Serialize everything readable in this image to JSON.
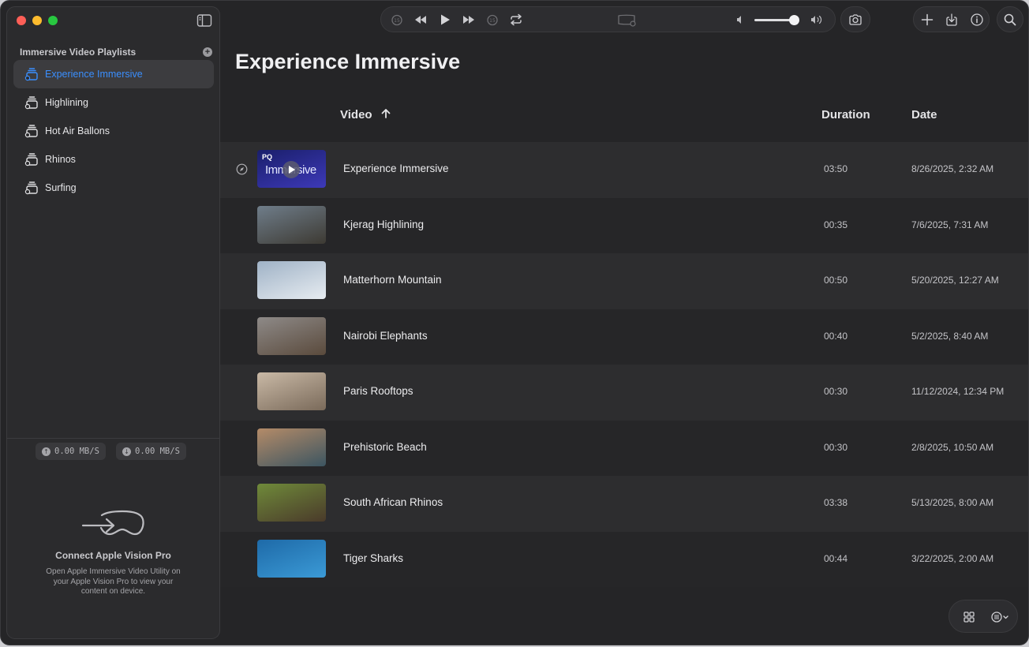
{
  "sidebar": {
    "header": "Immersive Video Playlists",
    "playlists": [
      {
        "label": "Experience Immersive",
        "active": true
      },
      {
        "label": "Highlining",
        "active": false
      },
      {
        "label": "Hot Air Ballons",
        "active": false
      },
      {
        "label": "Rhinos",
        "active": false
      },
      {
        "label": "Surfing",
        "active": false
      }
    ],
    "upload_rate": "0.00 MB/S",
    "download_rate": "0.00 MB/S",
    "connect": {
      "title": "Connect Apple Vision Pro",
      "description": "Open Apple Immersive Video Utility on your Apple Vision Pro to view your content on device."
    }
  },
  "toolbar": {
    "icons": [
      "skip-back-15-icon",
      "rewind-icon",
      "play-icon",
      "fast-forward-icon",
      "skip-forward-15-icon",
      "repeat-icon",
      "screen-placeholder-icon",
      "volume-low-icon",
      "volume-high-icon",
      "camera-icon",
      "plus-icon",
      "import-icon",
      "info-icon",
      "search-icon"
    ],
    "volume_level": 0.9
  },
  "main": {
    "title": "Experience Immersive",
    "columns": {
      "video": "Video",
      "duration": "Duration",
      "date": "Date"
    },
    "rows": [
      {
        "title": "Experience Immersive",
        "duration": "03:50",
        "date": "8/26/2025, 2:32 AM",
        "thumb_text_pq": "PQ",
        "thumb_text_word": "Immersive",
        "colors": [
          "#1a1f6b",
          "#3d39b8"
        ]
      },
      {
        "title": "Kjerag Highlining",
        "duration": "00:35",
        "date": "7/6/2025, 7:31 AM",
        "colors": [
          "#6f7d8a",
          "#3d3a33"
        ]
      },
      {
        "title": "Matterhorn Mountain",
        "duration": "00:50",
        "date": "5/20/2025, 12:27 AM",
        "colors": [
          "#9fb2c6",
          "#e7ecf1"
        ]
      },
      {
        "title": "Nairobi Elephants",
        "duration": "00:40",
        "date": "5/2/2025, 8:40 AM",
        "colors": [
          "#8e8a88",
          "#5a4a3c"
        ]
      },
      {
        "title": "Paris Rooftops",
        "duration": "00:30",
        "date": "11/12/2024, 12:34 PM",
        "colors": [
          "#c9b9a6",
          "#7a6a5a"
        ]
      },
      {
        "title": "Prehistoric Beach",
        "duration": "00:30",
        "date": "2/8/2025, 10:50 AM",
        "colors": [
          "#b48b68",
          "#3c5561"
        ]
      },
      {
        "title": "South African Rhinos",
        "duration": "03:38",
        "date": "5/13/2025, 8:00 AM",
        "colors": [
          "#6f8a3a",
          "#4a3a2a"
        ]
      },
      {
        "title": "Tiger Sharks",
        "duration": "00:44",
        "date": "3/22/2025, 2:00 AM",
        "colors": [
          "#1e6aa8",
          "#3b9ad6"
        ]
      }
    ]
  },
  "accent": "#3a8fff"
}
